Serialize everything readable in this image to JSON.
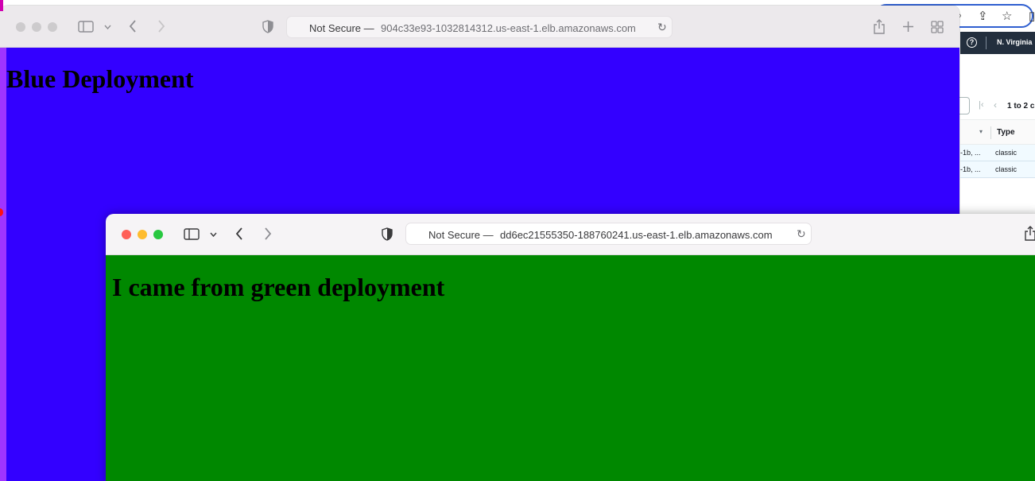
{
  "background_window": {
    "region": "N. Virginia",
    "help_icon": "help-circle-icon",
    "pagination_text": "1 to 2 c",
    "table_header": "Type",
    "rows": [
      {
        "az": "-1b, ...",
        "type": "classic"
      },
      {
        "az": "-1b, ...",
        "type": "classic"
      }
    ]
  },
  "blue_window": {
    "url_prefix": "Not Secure —",
    "url_host": "904c33e93-1032814312.us-east-1.elb.amazonaws.com",
    "heading": "Blue Deployment",
    "content_color": "#3300ff"
  },
  "green_window": {
    "url_prefix": "Not Secure —",
    "url_host": "dd6ec21555350-188760241.us-east-1.elb.amazonaws.com",
    "heading": "I came from green deployment",
    "content_color": "#008800"
  },
  "traffic_light_colors": {
    "close": "#ff5f57",
    "minimize": "#febc2e",
    "zoom": "#28c840",
    "inactive": "#cdcbcd"
  }
}
